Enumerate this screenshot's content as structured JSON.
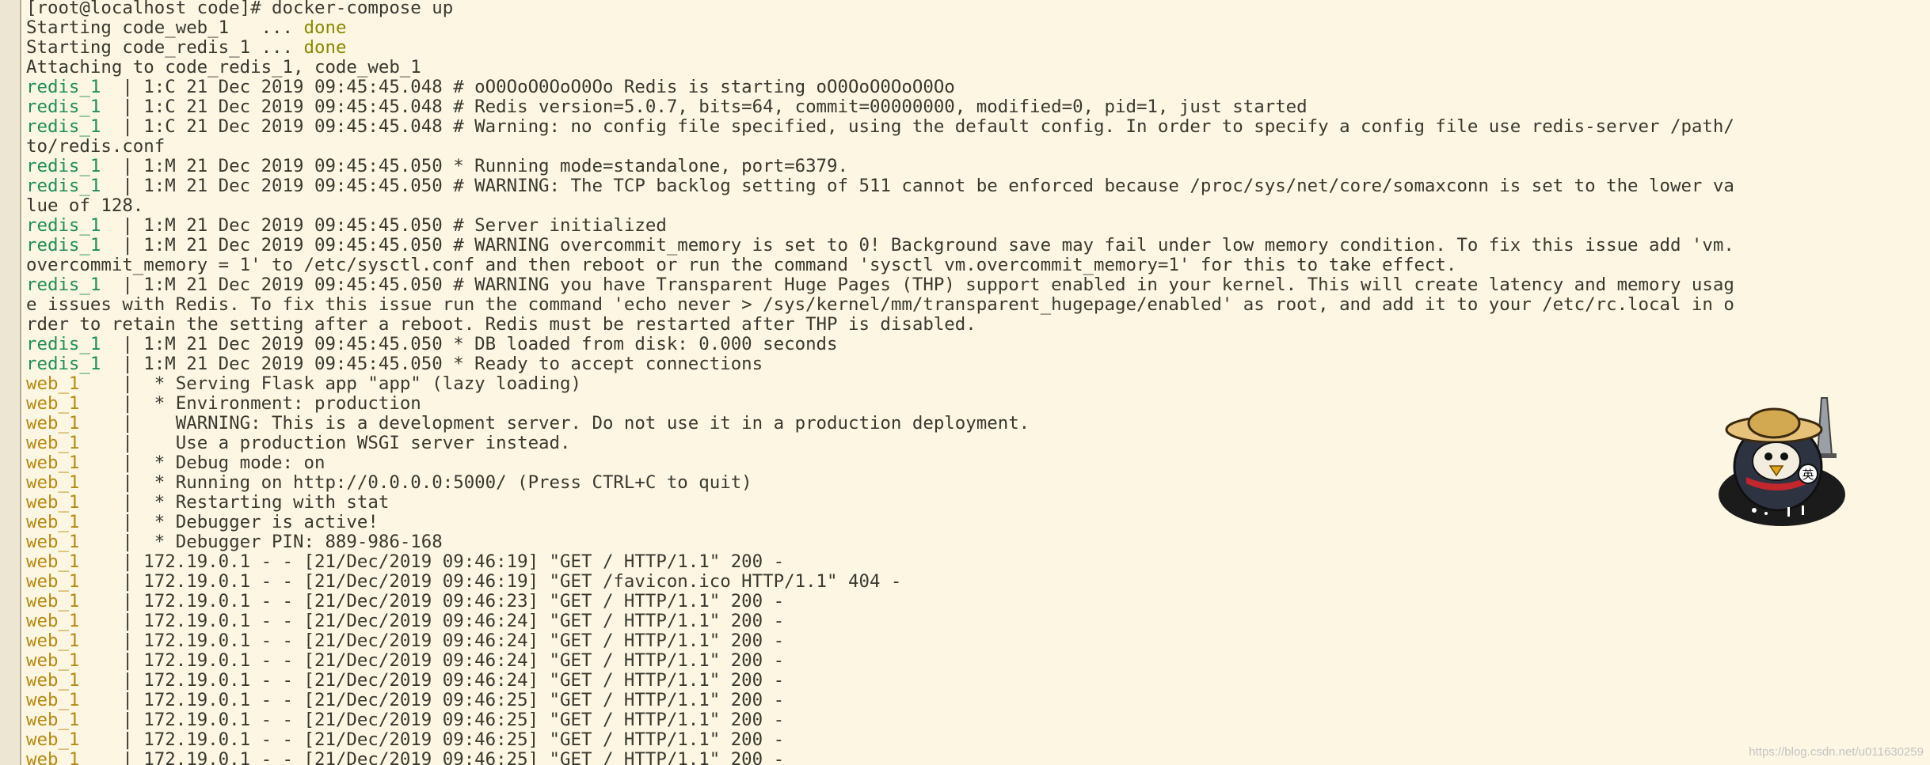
{
  "terminal": {
    "lines": [
      {
        "prefix": "",
        "kind": "plain",
        "text": "[root@localhost code]# docker-compose up"
      },
      {
        "prefix": "",
        "kind": "plain",
        "text": "Starting code_web_1   ... ",
        "suffix": "done"
      },
      {
        "prefix": "",
        "kind": "plain",
        "text": "Starting code_redis_1 ... ",
        "suffix": "done"
      },
      {
        "prefix": "",
        "kind": "plain",
        "text": "Attaching to code_redis_1, code_web_1"
      },
      {
        "prefix": "redis_1  ",
        "kind": "redis",
        "text": "| 1:C 21 Dec 2019 09:45:45.048 # oO0OoO0OoO0Oo Redis is starting oO0OoO0OoO0Oo"
      },
      {
        "prefix": "redis_1  ",
        "kind": "redis",
        "text": "| 1:C 21 Dec 2019 09:45:45.048 # Redis version=5.0.7, bits=64, commit=00000000, modified=0, pid=1, just started"
      },
      {
        "prefix": "redis_1  ",
        "kind": "redis",
        "text": "| 1:C 21 Dec 2019 09:45:45.048 # Warning: no config file specified, using the default config. In order to specify a config file use redis-server /path/"
      },
      {
        "prefix": "",
        "kind": "plain",
        "text": "to/redis.conf"
      },
      {
        "prefix": "redis_1  ",
        "kind": "redis",
        "text": "| 1:M 21 Dec 2019 09:45:45.050 * Running mode=standalone, port=6379."
      },
      {
        "prefix": "redis_1  ",
        "kind": "redis",
        "text": "| 1:M 21 Dec 2019 09:45:45.050 # WARNING: The TCP backlog setting of 511 cannot be enforced because /proc/sys/net/core/somaxconn is set to the lower va"
      },
      {
        "prefix": "",
        "kind": "plain",
        "text": "lue of 128."
      },
      {
        "prefix": "redis_1  ",
        "kind": "redis",
        "text": "| 1:M 21 Dec 2019 09:45:45.050 # Server initialized"
      },
      {
        "prefix": "redis_1  ",
        "kind": "redis",
        "text": "| 1:M 21 Dec 2019 09:45:45.050 # WARNING overcommit_memory is set to 0! Background save may fail under low memory condition. To fix this issue add 'vm."
      },
      {
        "prefix": "",
        "kind": "plain",
        "text": "overcommit_memory = 1' to /etc/sysctl.conf and then reboot or run the command 'sysctl vm.overcommit_memory=1' for this to take effect."
      },
      {
        "prefix": "redis_1  ",
        "kind": "redis",
        "text": "| 1:M 21 Dec 2019 09:45:45.050 # WARNING you have Transparent Huge Pages (THP) support enabled in your kernel. This will create latency and memory usag"
      },
      {
        "prefix": "",
        "kind": "plain",
        "text": "e issues with Redis. To fix this issue run the command 'echo never > /sys/kernel/mm/transparent_hugepage/enabled' as root, and add it to your /etc/rc.local in o"
      },
      {
        "prefix": "",
        "kind": "plain",
        "text": "rder to retain the setting after a reboot. Redis must be restarted after THP is disabled."
      },
      {
        "prefix": "redis_1  ",
        "kind": "redis",
        "text": "| 1:M 21 Dec 2019 09:45:45.050 * DB loaded from disk: 0.000 seconds"
      },
      {
        "prefix": "redis_1  ",
        "kind": "redis",
        "text": "| 1:M 21 Dec 2019 09:45:45.050 * Ready to accept connections"
      },
      {
        "prefix": "web_1    ",
        "kind": "web",
        "text": "|  * Serving Flask app \"app\" (lazy loading)"
      },
      {
        "prefix": "web_1    ",
        "kind": "web",
        "text": "|  * Environment: production"
      },
      {
        "prefix": "web_1    ",
        "kind": "web",
        "text": "|    WARNING: This is a development server. Do not use it in a production deployment."
      },
      {
        "prefix": "web_1    ",
        "kind": "web",
        "text": "|    Use a production WSGI server instead."
      },
      {
        "prefix": "web_1    ",
        "kind": "web",
        "text": "|  * Debug mode: on"
      },
      {
        "prefix": "web_1    ",
        "kind": "web",
        "text": "|  * Running on http://0.0.0.0:5000/ (Press CTRL+C to quit)"
      },
      {
        "prefix": "web_1    ",
        "kind": "web",
        "text": "|  * Restarting with stat"
      },
      {
        "prefix": "web_1    ",
        "kind": "web",
        "text": "|  * Debugger is active!"
      },
      {
        "prefix": "web_1    ",
        "kind": "web",
        "text": "|  * Debugger PIN: 889-986-168"
      },
      {
        "prefix": "web_1    ",
        "kind": "web",
        "text": "| 172.19.0.1 - - [21/Dec/2019 09:46:19] \"GET / HTTP/1.1\" 200 -"
      },
      {
        "prefix": "web_1    ",
        "kind": "web",
        "text": "| 172.19.0.1 - - [21/Dec/2019 09:46:19] \"GET /favicon.ico HTTP/1.1\" 404 -"
      },
      {
        "prefix": "web_1    ",
        "kind": "web",
        "text": "| 172.19.0.1 - - [21/Dec/2019 09:46:23] \"GET / HTTP/1.1\" 200 -"
      },
      {
        "prefix": "web_1    ",
        "kind": "web",
        "text": "| 172.19.0.1 - - [21/Dec/2019 09:46:24] \"GET / HTTP/1.1\" 200 -"
      },
      {
        "prefix": "web_1    ",
        "kind": "web",
        "text": "| 172.19.0.1 - - [21/Dec/2019 09:46:24] \"GET / HTTP/1.1\" 200 -"
      },
      {
        "prefix": "web_1    ",
        "kind": "web",
        "text": "| 172.19.0.1 - - [21/Dec/2019 09:46:24] \"GET / HTTP/1.1\" 200 -"
      },
      {
        "prefix": "web_1    ",
        "kind": "web",
        "text": "| 172.19.0.1 - - [21/Dec/2019 09:46:24] \"GET / HTTP/1.1\" 200 -"
      },
      {
        "prefix": "web_1    ",
        "kind": "web",
        "text": "| 172.19.0.1 - - [21/Dec/2019 09:46:25] \"GET / HTTP/1.1\" 200 -"
      },
      {
        "prefix": "web_1    ",
        "kind": "web",
        "text": "| 172.19.0.1 - - [21/Dec/2019 09:46:25] \"GET / HTTP/1.1\" 200 -"
      },
      {
        "prefix": "web_1    ",
        "kind": "web",
        "text": "| 172.19.0.1 - - [21/Dec/2019 09:46:25] \"GET / HTTP/1.1\" 200 -"
      },
      {
        "prefix": "web_1    ",
        "kind": "web",
        "text": "| 172.19.0.1 - - [21/Dec/2019 09:46:25] \"GET / HTTP/1.1\" 200 -"
      }
    ]
  },
  "colors": {
    "background": "#fdf6e3",
    "text": "#39392f",
    "redis_prefix": "#1f8f5a",
    "web_prefix": "#b6890f",
    "done": "#8a8a00"
  },
  "mascot": {
    "icon": "ninja-penguin-icon",
    "glyph": "英"
  },
  "watermark": "https://blog.csdn.net/u011630259"
}
